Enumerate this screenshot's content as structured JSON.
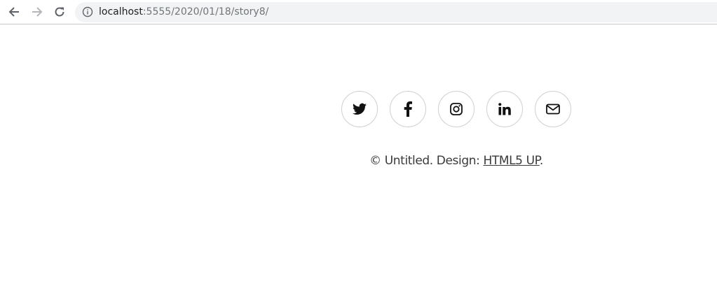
{
  "browser": {
    "url_host": "localhost",
    "url_path": ":5555/2020/01/18/story8/",
    "back_icon": "arrow-left-icon",
    "forward_icon": "arrow-right-icon",
    "reload_icon": "reload-icon",
    "site_info_icon": "info-icon"
  },
  "footer": {
    "social_icons": [
      "twitter-icon",
      "facebook-icon",
      "instagram-icon",
      "linkedin-icon",
      "envelope-icon"
    ],
    "copyright_prefix": "© Untitled. Design: ",
    "design_link": "HTML5 UP",
    "copyright_suffix": "."
  },
  "colors": {
    "omnibox_bg": "#f1f3f4",
    "icon_border": "#d0d0d0",
    "text": "#3a3a3a"
  }
}
